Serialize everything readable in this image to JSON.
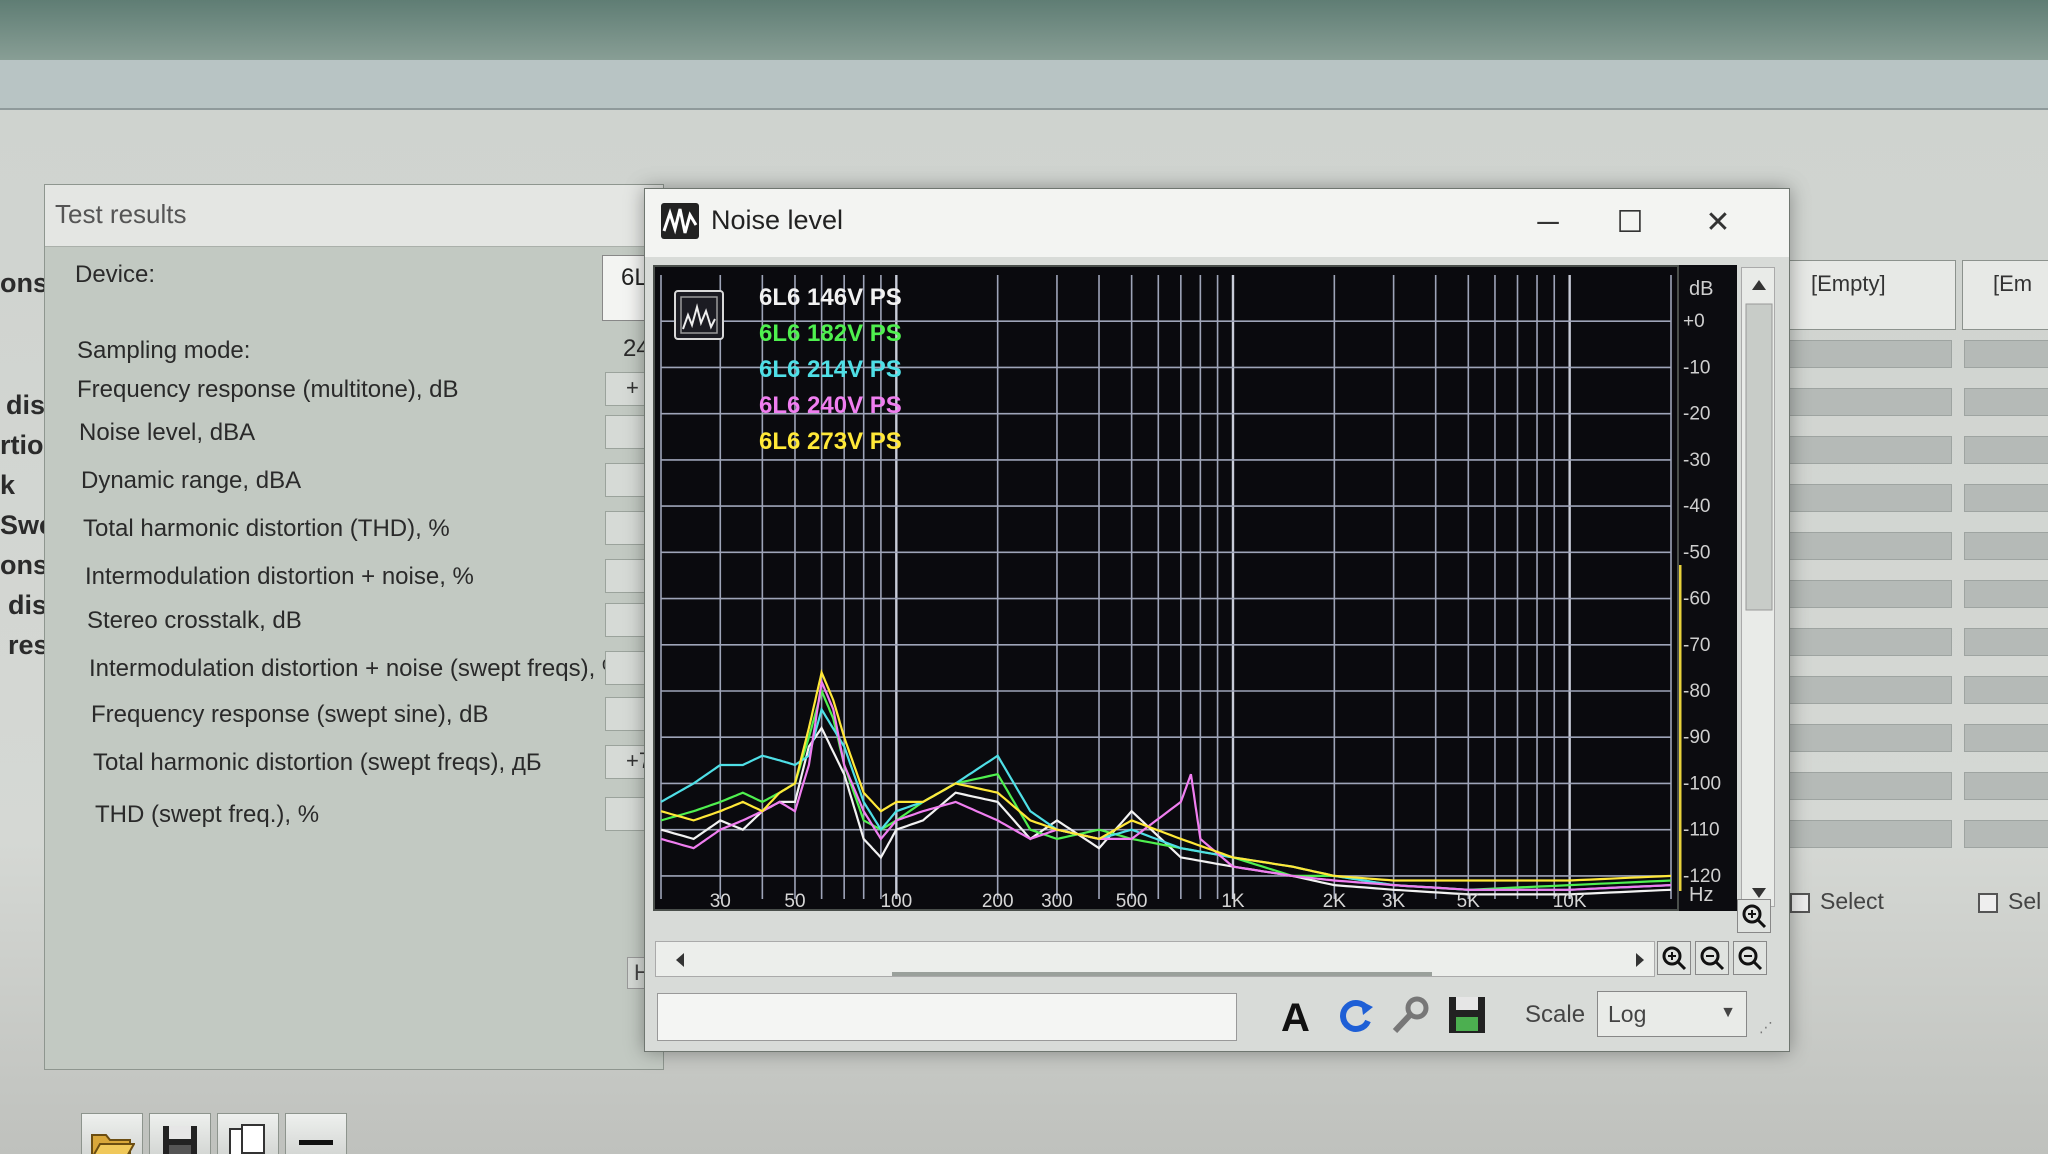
{
  "background": {
    "left_fragments": [
      "ons",
      "dist",
      "rtio",
      "k",
      "Swe",
      "ons",
      "dist",
      "resp"
    ],
    "right_headers": [
      "[Empty]",
      "[Em"
    ],
    "select_labels": [
      "Select",
      "Sel"
    ]
  },
  "test_results": {
    "title": "Test results",
    "device_label": "Device:",
    "device_value": "6L",
    "sampling_label": "Sampling mode:",
    "sampling_value": "24",
    "rows": [
      {
        "label": "Frequency response (multitone), dB",
        "value": "+"
      },
      {
        "label": "Noise level, dBA",
        "value": ""
      },
      {
        "label": "Dynamic range, dBA",
        "value": ""
      },
      {
        "label": "Total harmonic distortion (THD), %",
        "value": ""
      },
      {
        "label": "Intermodulation distortion + noise, %",
        "value": ""
      },
      {
        "label": "Stereo crosstalk, dB",
        "value": ""
      },
      {
        "label": "Intermodulation distortion + noise (swept freqs), %",
        "value": ""
      },
      {
        "label": "Frequency response (swept sine), dB",
        "value": ""
      },
      {
        "label": "Total harmonic distortion (swept freqs), дБ",
        "value": "+7"
      },
      {
        "label": "THD (swept freq.), %",
        "value": ""
      }
    ],
    "side_letter": "H",
    "toolbar": [
      "open-folder",
      "save",
      "copy",
      "minus"
    ]
  },
  "noise_window": {
    "title": "Noise level",
    "controls": {
      "minimize": "─",
      "maximize": "☐",
      "close": "✕"
    },
    "scale_label": "Scale",
    "scale_value": "Log",
    "db_unit": "dB",
    "hz_unit": "Hz"
  },
  "chart_data": {
    "type": "line",
    "xlabel": "Hz",
    "ylabel": "dB",
    "xscale": "log",
    "xlim": [
      20,
      20000
    ],
    "ylim": [
      -125,
      10
    ],
    "x_ticks": [
      "30",
      "50",
      "100",
      "200",
      "300",
      "500",
      "1K",
      "2K",
      "3K",
      "5K",
      "10K"
    ],
    "x_tick_values": [
      30,
      50,
      100,
      200,
      300,
      500,
      1000,
      2000,
      3000,
      5000,
      10000
    ],
    "y_ticks": [
      "+0",
      "-10",
      "-20",
      "-30",
      "-40",
      "-50",
      "-60",
      "-70",
      "-80",
      "-90",
      "-100",
      "-110",
      "-120"
    ],
    "y_tick_values": [
      0,
      -10,
      -20,
      -30,
      -40,
      -50,
      -60,
      -70,
      -80,
      -90,
      -100,
      -110,
      -120
    ],
    "grid": true,
    "legend_position": "top-left",
    "series": [
      {
        "name": "6L6 146V PS",
        "color": "#f2f2f2",
        "points": [
          [
            20,
            -110
          ],
          [
            25,
            -112
          ],
          [
            30,
            -108
          ],
          [
            35,
            -110
          ],
          [
            40,
            -106
          ],
          [
            45,
            -104
          ],
          [
            50,
            -104
          ],
          [
            55,
            -92
          ],
          [
            60,
            -88
          ],
          [
            70,
            -98
          ],
          [
            80,
            -112
          ],
          [
            90,
            -116
          ],
          [
            100,
            -110
          ],
          [
            120,
            -108
          ],
          [
            150,
            -102
          ],
          [
            200,
            -104
          ],
          [
            250,
            -112
          ],
          [
            300,
            -108
          ],
          [
            400,
            -114
          ],
          [
            500,
            -106
          ],
          [
            700,
            -116
          ],
          [
            1000,
            -118
          ],
          [
            1500,
            -120
          ],
          [
            2000,
            -122
          ],
          [
            3000,
            -123
          ],
          [
            5000,
            -124
          ],
          [
            10000,
            -124
          ],
          [
            20000,
            -123
          ]
        ]
      },
      {
        "name": "6L6 182V PS",
        "color": "#4ff04f",
        "points": [
          [
            20,
            -108
          ],
          [
            25,
            -106
          ],
          [
            30,
            -104
          ],
          [
            35,
            -102
          ],
          [
            40,
            -104
          ],
          [
            45,
            -102
          ],
          [
            50,
            -100
          ],
          [
            55,
            -90
          ],
          [
            60,
            -80
          ],
          [
            65,
            -86
          ],
          [
            70,
            -96
          ],
          [
            80,
            -108
          ],
          [
            90,
            -110
          ],
          [
            100,
            -108
          ],
          [
            120,
            -104
          ],
          [
            150,
            -100
          ],
          [
            200,
            -98
          ],
          [
            250,
            -110
          ],
          [
            300,
            -112
          ],
          [
            400,
            -110
          ],
          [
            500,
            -112
          ],
          [
            700,
            -114
          ],
          [
            1000,
            -116
          ],
          [
            1500,
            -120
          ],
          [
            2000,
            -120
          ],
          [
            3000,
            -122
          ],
          [
            5000,
            -123
          ],
          [
            10000,
            -122
          ],
          [
            20000,
            -121
          ]
        ]
      },
      {
        "name": "6L6 214V PS",
        "color": "#4fdfe6",
        "points": [
          [
            20,
            -104
          ],
          [
            25,
            -100
          ],
          [
            30,
            -96
          ],
          [
            35,
            -96
          ],
          [
            40,
            -94
          ],
          [
            45,
            -95
          ],
          [
            50,
            -96
          ],
          [
            55,
            -94
          ],
          [
            60,
            -84
          ],
          [
            70,
            -92
          ],
          [
            80,
            -104
          ],
          [
            90,
            -110
          ],
          [
            100,
            -106
          ],
          [
            120,
            -104
          ],
          [
            150,
            -100
          ],
          [
            200,
            -94
          ],
          [
            250,
            -106
          ],
          [
            300,
            -110
          ],
          [
            400,
            -112
          ],
          [
            500,
            -110
          ],
          [
            700,
            -114
          ],
          [
            1000,
            -116
          ],
          [
            1500,
            -118
          ],
          [
            2000,
            -120
          ],
          [
            3000,
            -122
          ],
          [
            5000,
            -123
          ],
          [
            10000,
            -123
          ],
          [
            20000,
            -122
          ]
        ]
      },
      {
        "name": "6L6 240V PS",
        "color": "#f07ef0",
        "points": [
          [
            20,
            -112
          ],
          [
            25,
            -114
          ],
          [
            30,
            -110
          ],
          [
            35,
            -108
          ],
          [
            40,
            -106
          ],
          [
            45,
            -104
          ],
          [
            50,
            -106
          ],
          [
            55,
            -96
          ],
          [
            60,
            -78
          ],
          [
            65,
            -84
          ],
          [
            70,
            -96
          ],
          [
            80,
            -106
          ],
          [
            90,
            -112
          ],
          [
            100,
            -108
          ],
          [
            120,
            -106
          ],
          [
            150,
            -104
          ],
          [
            200,
            -108
          ],
          [
            250,
            -112
          ],
          [
            300,
            -110
          ],
          [
            400,
            -112
          ],
          [
            500,
            -112
          ],
          [
            700,
            -104
          ],
          [
            750,
            -98
          ],
          [
            800,
            -112
          ],
          [
            1000,
            -118
          ],
          [
            1500,
            -120
          ],
          [
            2000,
            -121
          ],
          [
            3000,
            -122
          ],
          [
            5000,
            -123
          ],
          [
            10000,
            -123
          ],
          [
            20000,
            -122
          ]
        ]
      },
      {
        "name": "6L6 273V PS",
        "color": "#ffe838",
        "points": [
          [
            20,
            -106
          ],
          [
            25,
            -108
          ],
          [
            30,
            -106
          ],
          [
            35,
            -104
          ],
          [
            40,
            -106
          ],
          [
            45,
            -102
          ],
          [
            50,
            -100
          ],
          [
            55,
            -88
          ],
          [
            60,
            -76
          ],
          [
            65,
            -82
          ],
          [
            70,
            -90
          ],
          [
            80,
            -102
          ],
          [
            90,
            -106
          ],
          [
            100,
            -104
          ],
          [
            120,
            -104
          ],
          [
            150,
            -100
          ],
          [
            200,
            -102
          ],
          [
            250,
            -108
          ],
          [
            300,
            -110
          ],
          [
            400,
            -112
          ],
          [
            500,
            -108
          ],
          [
            700,
            -112
          ],
          [
            1000,
            -116
          ],
          [
            1500,
            -118
          ],
          [
            2000,
            -120
          ],
          [
            3000,
            -121
          ],
          [
            5000,
            -121
          ],
          [
            10000,
            -121
          ],
          [
            20000,
            -120
          ]
        ]
      }
    ]
  }
}
